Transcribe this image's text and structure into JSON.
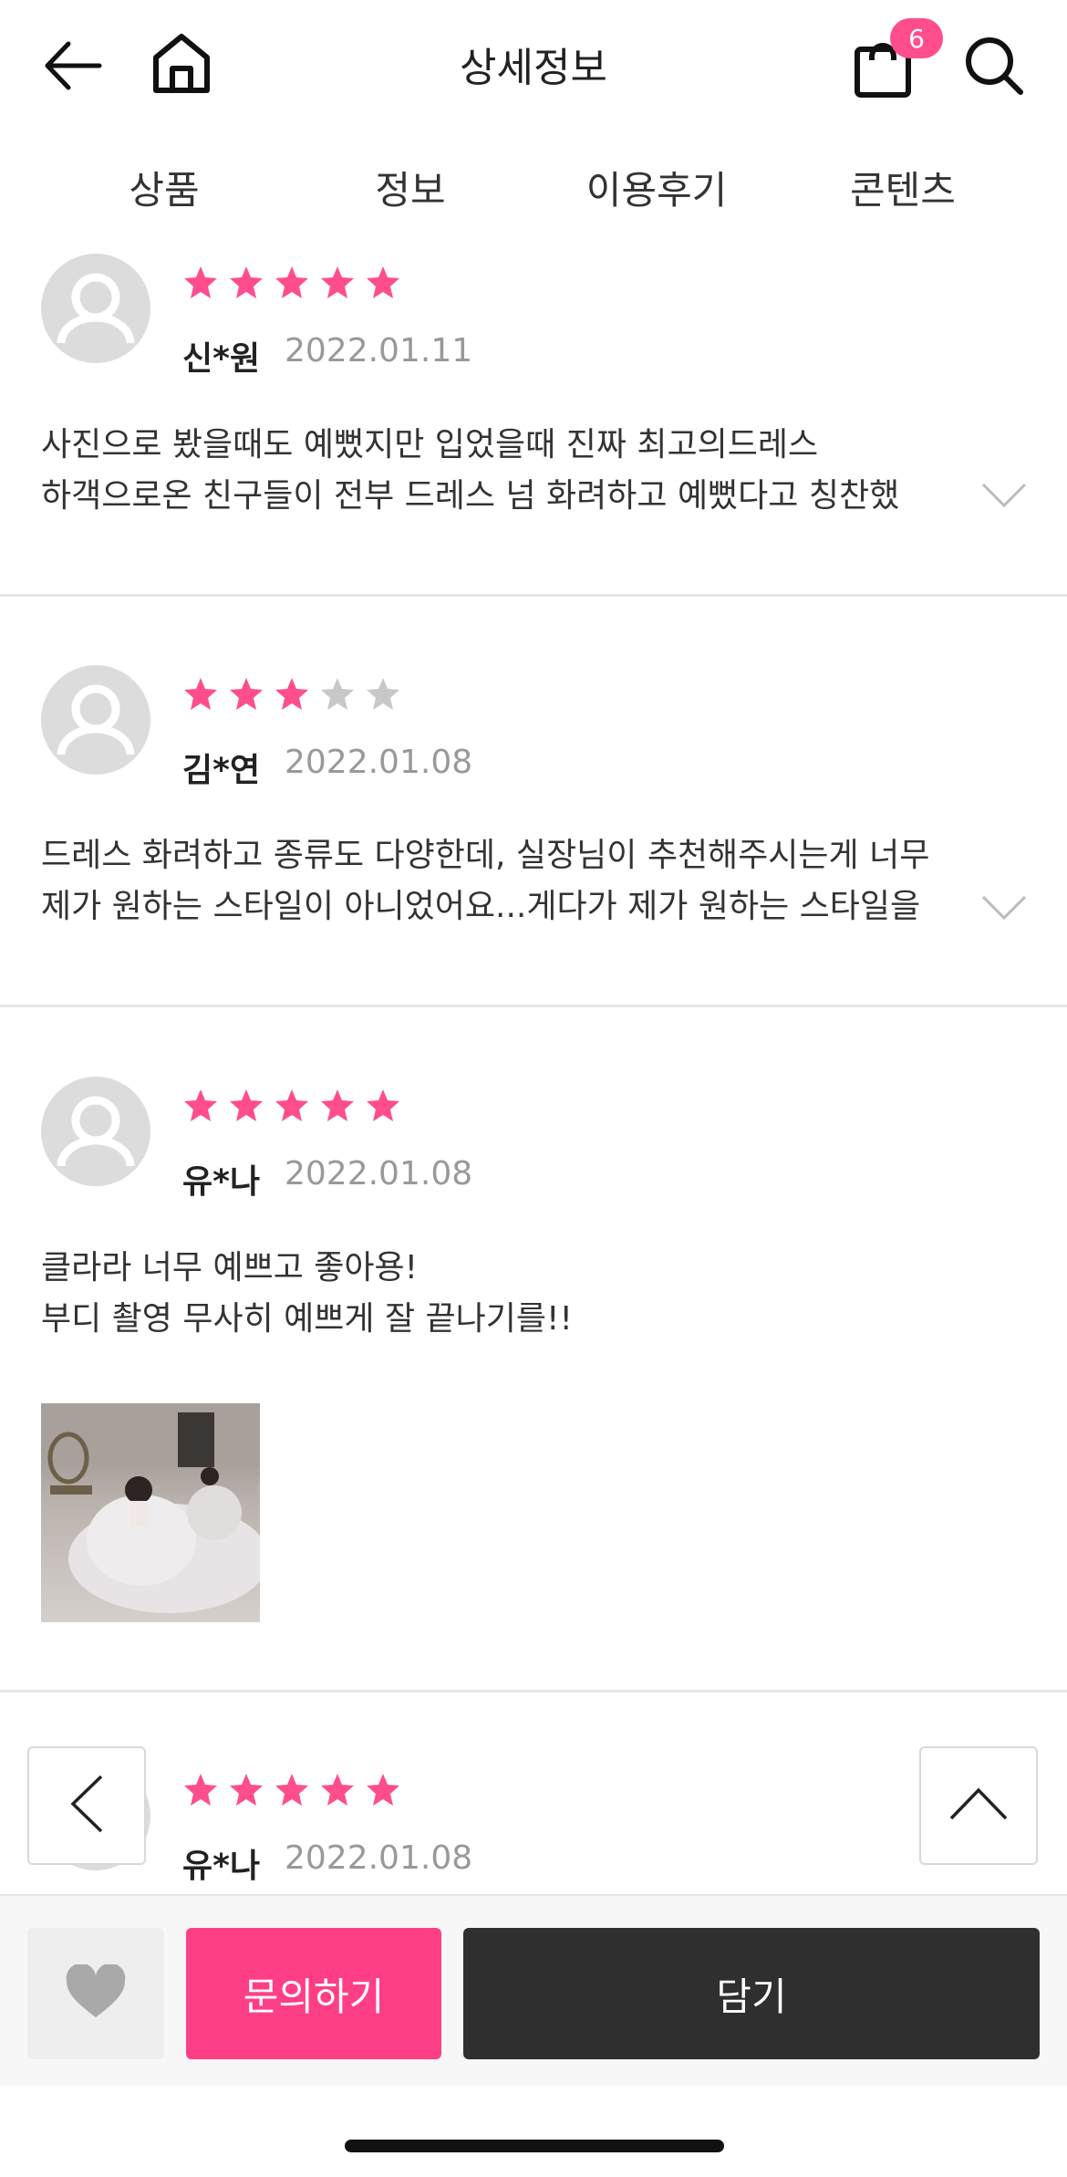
{
  "header": {
    "title": "상세정보",
    "cart_count": "6"
  },
  "tabs": [
    {
      "label": "상품"
    },
    {
      "label": "정보"
    },
    {
      "label": "이용후기"
    },
    {
      "label": "콘텐츠"
    }
  ],
  "reviews": [
    {
      "rating": 5,
      "name": "신*원",
      "date": "2022.01.11",
      "line1": "사진으로 봤을때도 예뻤지만 입었을때 진짜 최고의드레스",
      "line2": "하객으로온 친구들이 전부 드레스 넘 화려하고 예뻤다고 칭찬했"
    },
    {
      "rating": 3,
      "name": "김*연",
      "date": "2022.01.08",
      "line1": "드레스 화려하고 종류도 다양한데, 실장님이 추천해주시는게 너무",
      "line2": "제가 원하는 스타일이 아니었어요...게다가 제가 원하는 스타일을"
    },
    {
      "rating": 5,
      "name": "유*나",
      "date": "2022.01.08",
      "line1": "클라라 너무 예쁘고 좋아용!",
      "line2": "부디 촬영 무사히 예쁘게 잘 끝나기를!!"
    },
    {
      "rating": 5,
      "name": "유*나",
      "date": "2022.01.08"
    }
  ],
  "bottom": {
    "inquiry_label": "문의하기",
    "cart_label": "담기"
  },
  "colors": {
    "accent": "#ff3f85",
    "star_on": "#ff4d8d",
    "star_off": "#c8c8c8",
    "dark_button": "#2f2f2f"
  }
}
